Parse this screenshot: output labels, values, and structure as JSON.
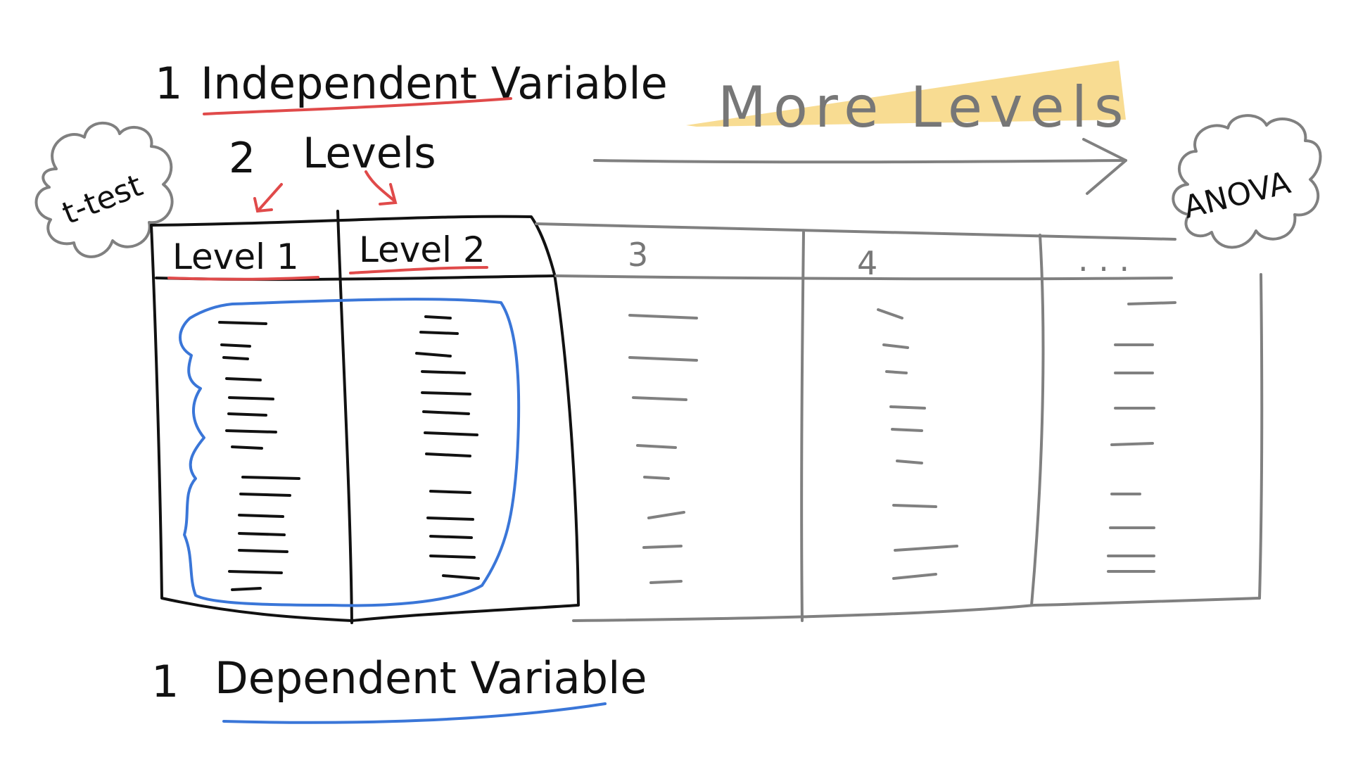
{
  "independent_variable": {
    "number": "1",
    "label": "Independent Variable"
  },
  "two_levels": {
    "number": "2",
    "label": "Levels"
  },
  "more_levels": "More Levels",
  "t_test": "t-test",
  "anova": "ANOVA",
  "columns": {
    "level1": "Level 1",
    "level2": "Level 2",
    "col3": "3",
    "col4": "4",
    "col_more": ". . ."
  },
  "dependent_variable": {
    "number": "1",
    "label": "Dependent Variable"
  },
  "colors": {
    "red": "#e04a4a",
    "blue": "#3a76d8",
    "highlight": "#f5d06e",
    "gray": "#808080",
    "ink": "#111111"
  }
}
